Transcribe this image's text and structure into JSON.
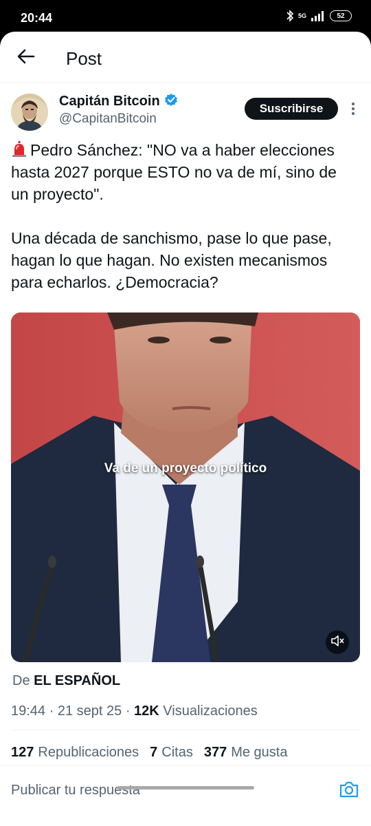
{
  "status_bar": {
    "time": "20:44",
    "network": "5G",
    "battery": "52"
  },
  "header": {
    "title": "Post"
  },
  "author": {
    "name": "Capitán Bitcoin",
    "handle": "@CapitanBitcoin",
    "verified": true,
    "subscribe_label": "Suscribirse"
  },
  "tweet": {
    "paragraph1": "Pedro Sánchez: \"NO va a haber elecciones hasta 2027 porque ESTO no va de mí, sino de un proyecto\".",
    "paragraph2": "Una década de sanchismo, pase lo que pase, hagan lo que hagan. No existen mecanismos para echarlos. ¿Democracia?",
    "emoji_icon": "rotating-light-icon"
  },
  "media": {
    "caption": "Va de un proyecto político",
    "mute_icon": "volume-muted-icon"
  },
  "source": {
    "prefix": "De",
    "name": "EL ESPAÑOL"
  },
  "meta": {
    "time": "19:44",
    "sep1": " · ",
    "date": "21 sept 25",
    "sep2": " · ",
    "views_count": "12K",
    "views_label": " Visualizaciones"
  },
  "stats": {
    "reposts_count": "127",
    "reposts_label": "Republicaciones",
    "quotes_count": "7",
    "quotes_label": "Citas",
    "likes_count": "377",
    "likes_label": "Me gusta"
  },
  "reply": {
    "placeholder": "Publicar tu respuesta"
  },
  "colors": {
    "accent": "#1d9bf0",
    "text": "#0f1419",
    "secondary": "#536471",
    "video_bg": "#c54a4b"
  }
}
